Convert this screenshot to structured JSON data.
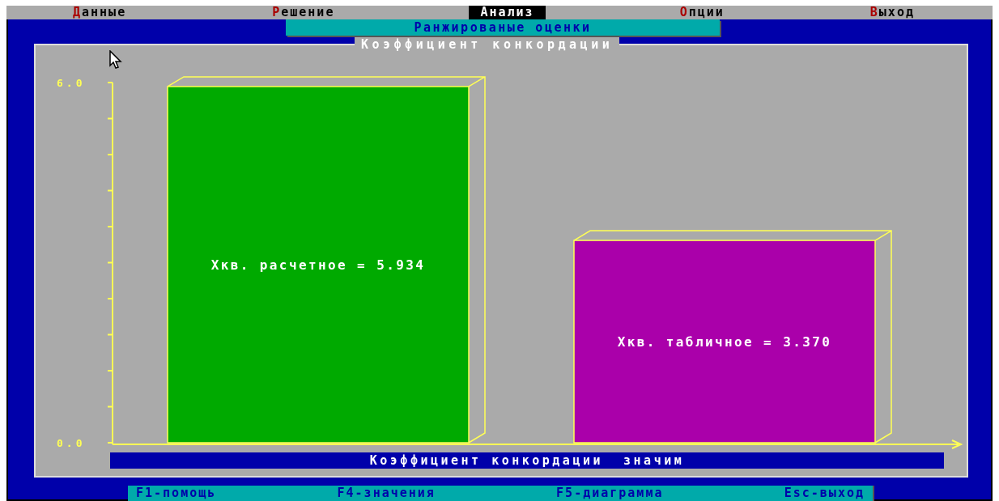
{
  "menu": [
    {
      "label": "Данные",
      "selected": false
    },
    {
      "label": "Решение",
      "selected": false
    },
    {
      "label": "Анализ",
      "selected": true
    },
    {
      "label": "Опции",
      "selected": false
    },
    {
      "label": "Выход",
      "selected": false
    }
  ],
  "submenu": {
    "title": "Ранжированые оценки"
  },
  "panel": {
    "title": "Коэффициент конкордации",
    "chart_data": {
      "type": "bar",
      "ylim": [
        0,
        6
      ],
      "yticks": [
        {
          "value": 0,
          "label": "0.0"
        },
        {
          "value": 6,
          "label": "6.0"
        }
      ],
      "series": [
        {
          "color": "#00aa00",
          "values": [
            5.934
          ]
        },
        {
          "color": "#aa00aa",
          "values": [
            3.37
          ]
        }
      ],
      "value_labels": [
        "Хкв. расчетное = 5.934",
        "Хкв. табличное = 3.370"
      ]
    },
    "conclusion": "Коэффициент конкордации  значим"
  },
  "keys": [
    "F1-помощь",
    "F4-значения",
    "F5-диаграмма",
    "Esc-выход"
  ]
}
